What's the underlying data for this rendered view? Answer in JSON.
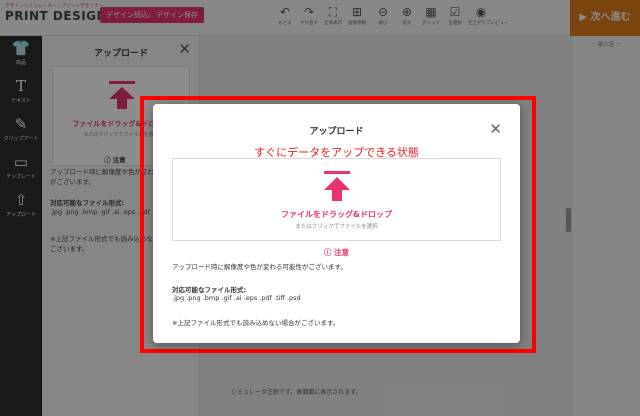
{
  "header": {
    "logo_sub": "デザインシミュレーター・プリントデザイナー",
    "logo_main": "PRINT DESIGNER",
    "btn_design_load": "デザイン読込み",
    "btn_design_save": "デザイン保存",
    "tools": [
      {
        "icon": "↶",
        "label": "もどる"
      },
      {
        "icon": "↷",
        "label": "やり直す"
      },
      {
        "icon": "⛶",
        "label": "全体表示"
      },
      {
        "icon": "⊞",
        "label": "画像移動"
      },
      {
        "icon": "⊖",
        "label": "縮小"
      },
      {
        "icon": "⊕",
        "label": "拡大"
      },
      {
        "icon": "▦",
        "label": "グリッド"
      },
      {
        "icon": "☑",
        "label": "全選択"
      },
      {
        "icon": "◉",
        "label": "仕上がりプレビュー"
      }
    ],
    "next_button": "▶ 次へ進む"
  },
  "sidebar": {
    "items": [
      {
        "icon": "👕",
        "label": "商品"
      },
      {
        "icon": "T",
        "label": "テキスト"
      },
      {
        "icon": "✎",
        "label": "クリップアート"
      },
      {
        "icon": "▭",
        "label": "テンプレート"
      },
      {
        "icon": "⇧",
        "label": "アップロード"
      }
    ]
  },
  "panel": {
    "title": "アップロード",
    "drop_main": "ファイルをドラッグ&ドロップ",
    "drop_sub": "またはクリックでファイルを選択",
    "notice": "ⓘ 注意",
    "text1": "アップロード時に解像度や色が変わる可能性",
    "text1b": "がございます。",
    "formats_label": "対応可能なファイル形式:",
    "formats": ".jpg .png .bmp .gif .ai .eps .pdf",
    "note": "※上記ファイル形式でも読み込めない場合が",
    "noteb": "ございます。"
  },
  "canvas": {
    "sim_note": "シミュレータ注釈です。表面面に表示されます。"
  },
  "right_panel": {
    "label": "－ 量れ感 －"
  },
  "modal": {
    "title": "アップロード",
    "annotation": "すぐにデータをアップできる状態",
    "drop_main": "ファイルをドラッグ&ドロップ",
    "drop_sub": "またはクリックでファイルを選択",
    "notice": "ⓘ 注意",
    "warning": "アップロード時に解像度や色が変わる可能性がございます。",
    "formats_label": "対応可能なファイル形式:",
    "formats": ".jpg .png .bmp .gif .ai .eps .pdf .tiff .psd",
    "note": "※上記ファイル形式でも読み込めない場合がございます。"
  },
  "colors": {
    "accent": "#e8336d",
    "next": "#e07a18",
    "highlight": "#ff0000"
  }
}
